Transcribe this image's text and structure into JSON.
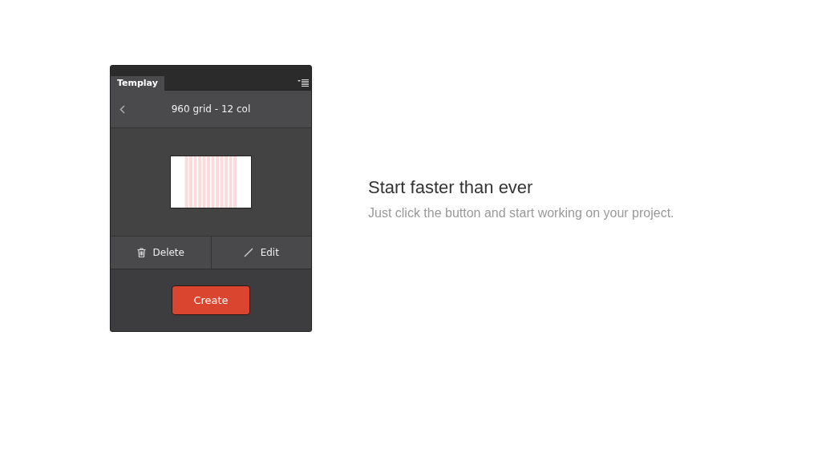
{
  "panel": {
    "tab": {
      "label": "Templay",
      "selected": true
    },
    "header": {
      "title": "960 grid - 12 col"
    },
    "actions": [
      {
        "label": "Delete",
        "kind": "delete"
      },
      {
        "label": "Edit",
        "kind": "edit"
      }
    ],
    "primary_button": "Create"
  },
  "feature": {
    "title": "Start faster than ever",
    "description": "Just click the button and start working on your project."
  }
}
